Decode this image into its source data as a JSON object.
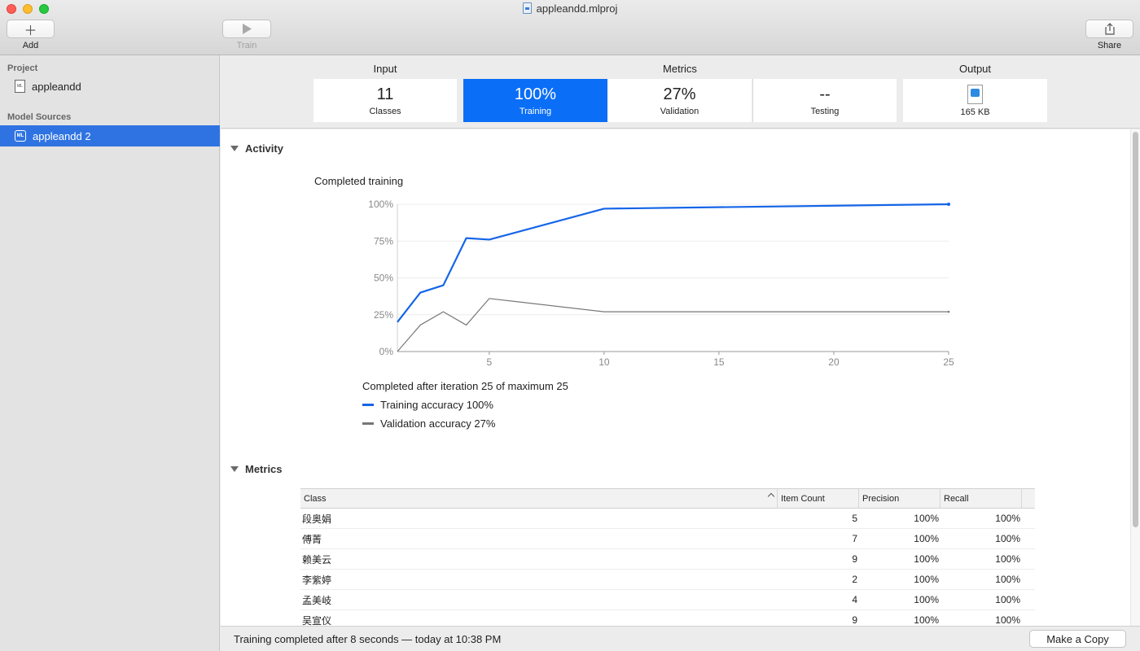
{
  "window": {
    "title": "appleandd.mlproj"
  },
  "toolbar": {
    "add_label": "Add",
    "train_label": "Train",
    "share_label": "Share"
  },
  "sidebar": {
    "project_header": "Project",
    "project_item": "appleandd",
    "sources_header": "Model Sources",
    "sources_item": "appleandd 2"
  },
  "header": {
    "input_title": "Input",
    "metrics_title": "Metrics",
    "output_title": "Output",
    "cards": {
      "classes": {
        "value": "11",
        "label": "Classes"
      },
      "training": {
        "value": "100%",
        "label": "Training"
      },
      "validation": {
        "value": "27%",
        "label": "Validation"
      },
      "testing": {
        "value": "--",
        "label": "Testing"
      },
      "output": {
        "label": "165 KB"
      }
    }
  },
  "activity": {
    "section_title": "Activity",
    "chart_title": "Completed training",
    "completed_text": "Completed after iteration 25 of maximum 25",
    "legend_training": "Training accuracy 100%",
    "legend_validation": "Validation accuracy 27%"
  },
  "chart_data": {
    "type": "line",
    "x_ticks": [
      5,
      10,
      15,
      20,
      25
    ],
    "y_ticks": [
      "0%",
      "25%",
      "50%",
      "75%",
      "100%"
    ],
    "xlim": [
      1,
      25
    ],
    "ylim": [
      0,
      100
    ],
    "series": [
      {
        "name": "Training accuracy",
        "color": "#1565e8",
        "x": [
          1,
          2,
          3,
          4,
          5,
          10,
          25
        ],
        "y": [
          20,
          40,
          45,
          77,
          76,
          97,
          100
        ]
      },
      {
        "name": "Validation accuracy",
        "color": "#777777",
        "x": [
          1,
          2,
          3,
          4,
          5,
          10,
          25
        ],
        "y": [
          0,
          18,
          27,
          18,
          36,
          27,
          27
        ]
      }
    ]
  },
  "metrics": {
    "section_title": "Metrics",
    "columns": [
      "Class",
      "Item Count",
      "Precision",
      "Recall"
    ],
    "rows": [
      {
        "cls": "段奥娟",
        "count": "5",
        "precision": "100%",
        "recall": "100%"
      },
      {
        "cls": "傅菁",
        "count": "7",
        "precision": "100%",
        "recall": "100%"
      },
      {
        "cls": "赖美云",
        "count": "9",
        "precision": "100%",
        "recall": "100%"
      },
      {
        "cls": "李紫婷",
        "count": "2",
        "precision": "100%",
        "recall": "100%"
      },
      {
        "cls": "孟美岐",
        "count": "4",
        "precision": "100%",
        "recall": "100%"
      },
      {
        "cls": "吴宣仪",
        "count": "9",
        "precision": "100%",
        "recall": "100%"
      }
    ]
  },
  "status": {
    "text": "Training completed after 8 seconds — today at 10:38 PM",
    "copy_button": "Make a Copy"
  }
}
